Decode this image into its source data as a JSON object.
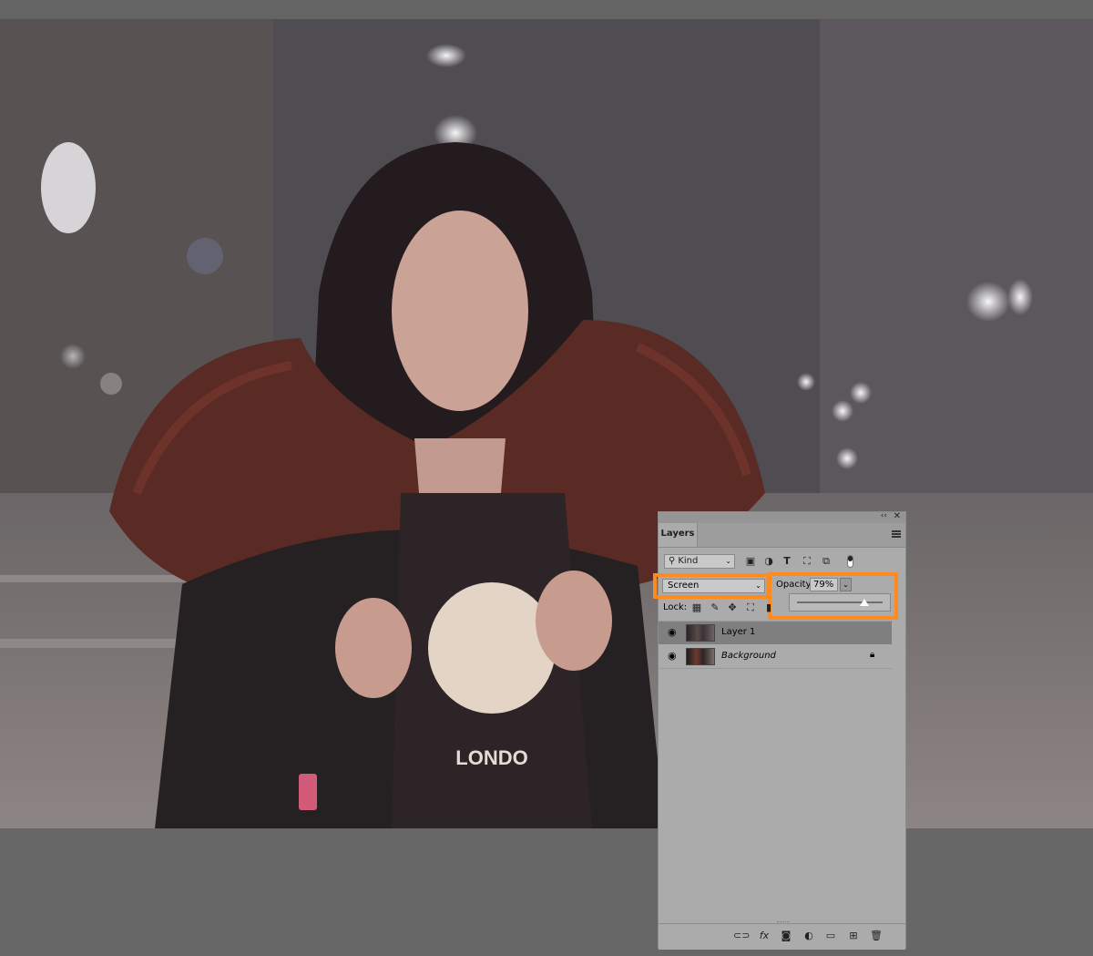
{
  "panel": {
    "title": "Layers",
    "collapse_icon": "double-chevron-left-icon",
    "close_icon": "close-icon"
  },
  "filter": {
    "kind_label": "Kind",
    "icons": [
      "image-filter-icon",
      "adjustment-filter-icon",
      "type-filter-icon",
      "shape-filter-icon",
      "smart-object-filter-icon"
    ],
    "type_glyph": "T"
  },
  "blend": {
    "mode": "Screen",
    "opacity_label": "Opacity:",
    "opacity_value": "79%",
    "opacity_level": 0.79
  },
  "lock": {
    "label": "Lock:"
  },
  "layers": [
    {
      "name": "Layer 1",
      "selected": true,
      "visible": true
    },
    {
      "name": "Background",
      "selected": false,
      "visible": true,
      "locked": true
    }
  ],
  "footer_icons": [
    "link-layers-icon",
    "fx-icon",
    "add-mask-icon",
    "adjustment-layer-icon",
    "new-group-icon",
    "new-layer-icon",
    "delete-layer-icon"
  ],
  "footer": {
    "fx_label": "fx"
  },
  "colors": {
    "highlight": "#ff8a1e",
    "panel_bg": "#ababab",
    "selected_layer": "#7f7f7f",
    "workspace": "#676767"
  }
}
